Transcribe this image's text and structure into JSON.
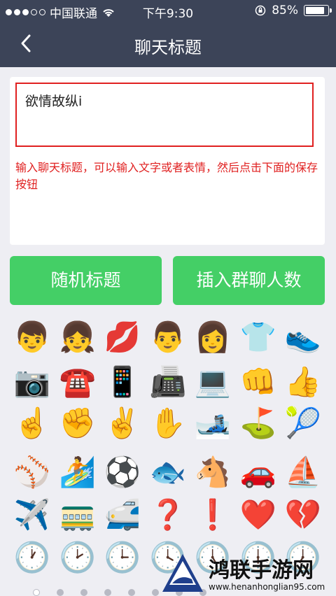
{
  "status": {
    "carrier": "中国联通",
    "time": "下午9:30",
    "battery": "85%",
    "battery_level": 0.85
  },
  "nav": {
    "title": "聊天标题",
    "back_icon": "chevron-left-icon"
  },
  "editor": {
    "value": "欲情故纵i",
    "hint": "输入聊天标题，可以输入文字或者表情，然后点击下面的保存按钮"
  },
  "buttons": {
    "random": "随机标题",
    "insert_count": "插入群聊人数"
  },
  "emoji_rows": [
    [
      "👦",
      "👧",
      "💋",
      "👨",
      "👩",
      "👕",
      "👟"
    ],
    [
      "📷",
      "☎️",
      "📱",
      "📠",
      "💻",
      "👊",
      "👍"
    ],
    [
      "☝️",
      "✊",
      "✌️",
      "✋",
      "🎿",
      "⛳",
      "🎾"
    ],
    [
      "⚾",
      "🏄",
      "⚽",
      "🐟",
      "🐴",
      "🚗",
      "⛵"
    ],
    [
      "✈️",
      "🚃",
      "🚅",
      "❓",
      "❗",
      "❤️",
      "💔"
    ],
    [
      "🕐",
      "🕑",
      "🕒",
      "🕓",
      "🕔",
      "🕕",
      "🕖"
    ]
  ],
  "pagination": {
    "pages": 8,
    "current": 1
  },
  "watermark": {
    "title": "鸿联手游网",
    "url": "www.henanhonglian95.com"
  }
}
